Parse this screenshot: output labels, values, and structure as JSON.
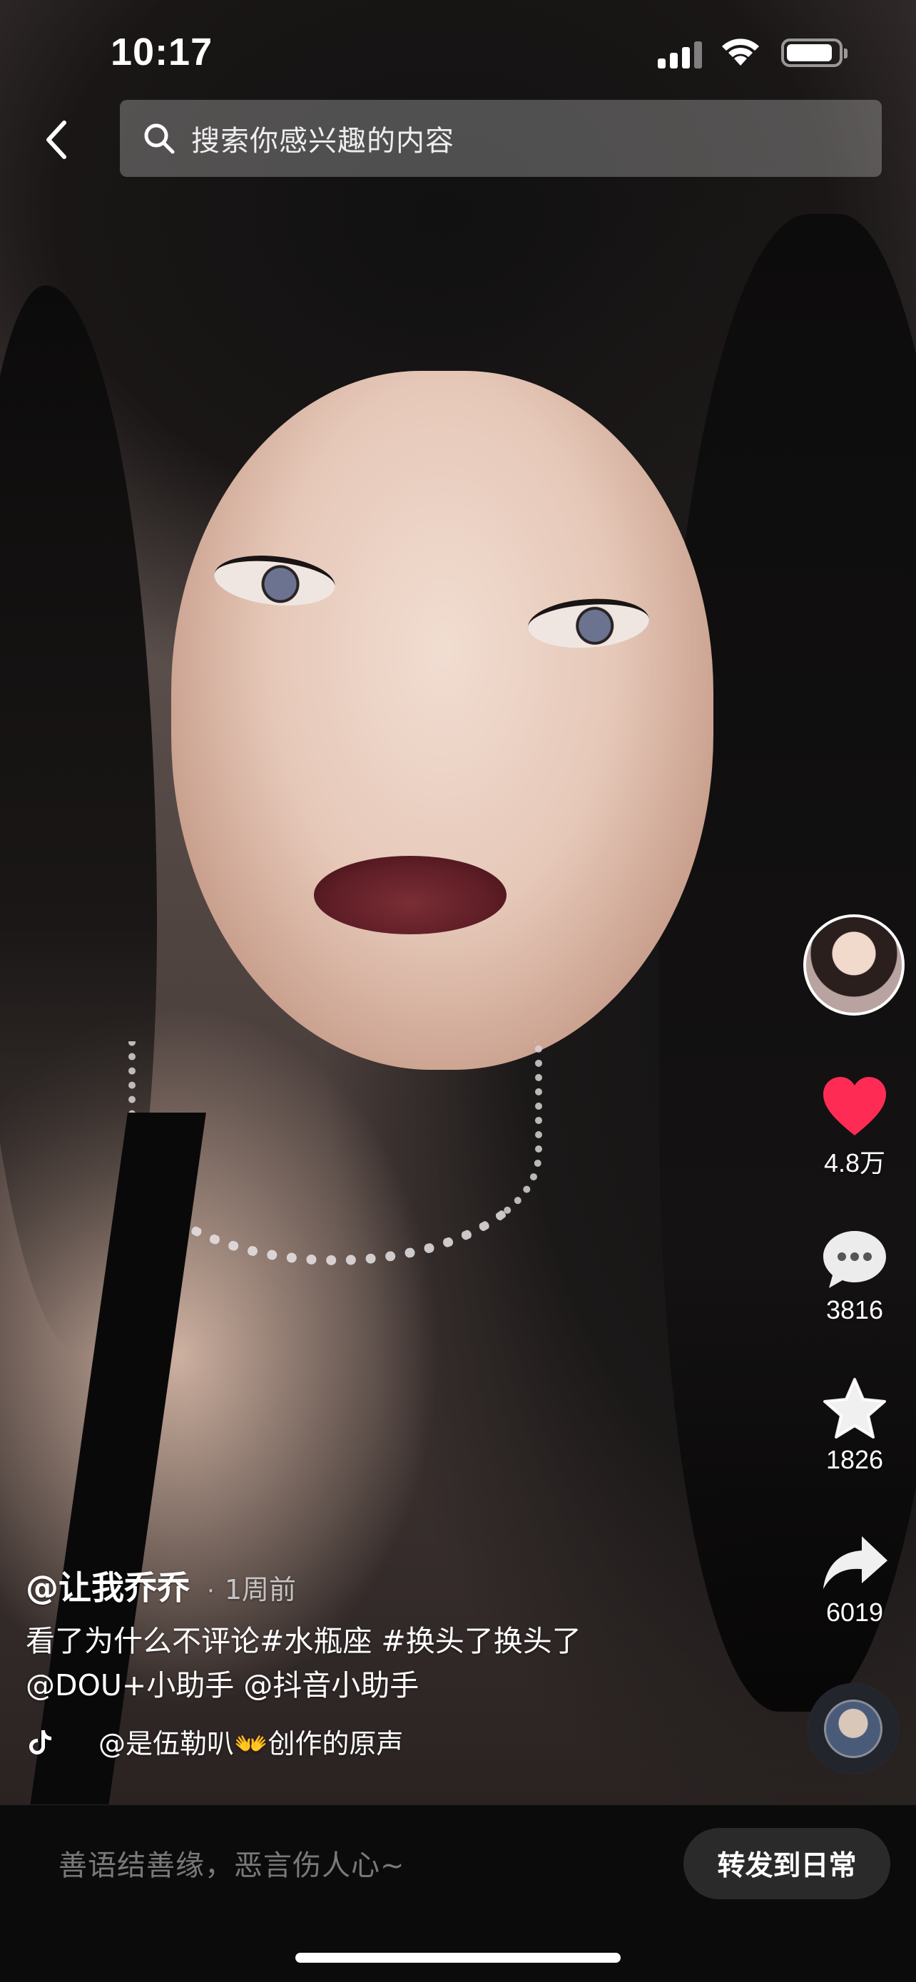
{
  "status_bar": {
    "time": "10:17",
    "battery_level": 0.9
  },
  "header": {
    "search_placeholder": "搜索你感兴趣的内容"
  },
  "actions": {
    "like_count": "4.8万",
    "comment_count": "3816",
    "favorite_count": "1826",
    "share_count": "6019",
    "like_color": "#FE2C55"
  },
  "post": {
    "author": "@让我乔乔",
    "time_ago": "1周前",
    "description_line1": "看了为什么不评论#水瓶座 #换头了换头了",
    "description_line2": "@DOU+小助手 @抖音小助手",
    "music": "@是伍勒叭👐创作的原声"
  },
  "comment_bar": {
    "placeholder": "善语结善缘，恶言伤人心~",
    "share_daily_label": "转发到日常"
  }
}
